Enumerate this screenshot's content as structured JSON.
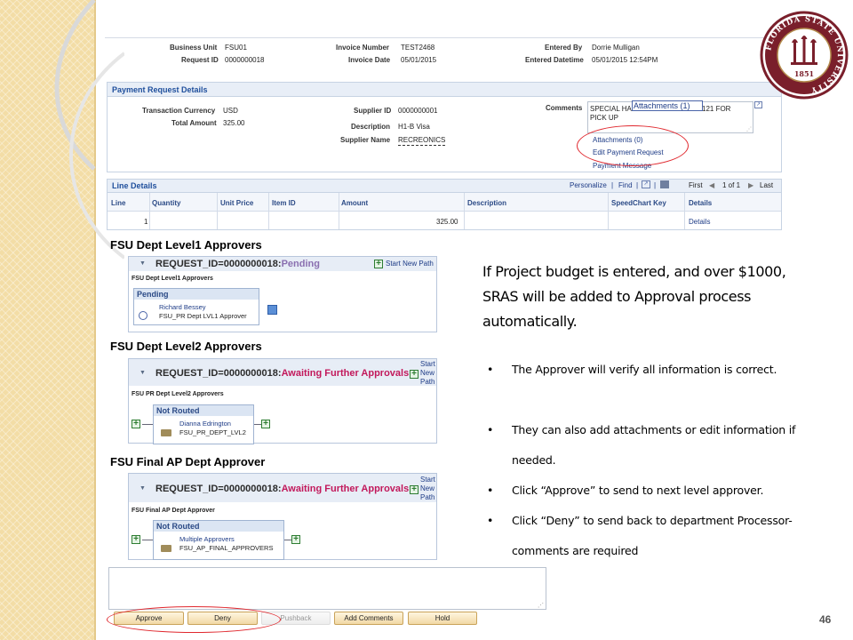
{
  "header": {
    "business_unit_label": "Business Unit",
    "business_unit": "FSU01",
    "request_id_label": "Request ID",
    "request_id": "0000000018",
    "invoice_number_label": "Invoice Number",
    "invoice_number": "TEST2468",
    "invoice_date_label": "Invoice Date",
    "invoice_date": "05/01/2015",
    "entered_by_label": "Entered By",
    "entered_by": "Dorrie Mulligan",
    "entered_datetime_label": "Entered Datetime",
    "entered_datetime": "05/01/2015 12:54PM"
  },
  "payment_request": {
    "title": "Payment Request Details",
    "currency_label": "Transaction Currency",
    "currency": "USD",
    "total_label": "Total Amount",
    "total": "325.00",
    "supplier_id_label": "Supplier ID",
    "supplier_id": "0000000001",
    "description_label": "Description",
    "description": "H1-B Visa",
    "supplier_name_label": "Supplier Name",
    "supplier_name": "RECREONICS",
    "comments_label": "Comments",
    "comments_line1": "SPECIAL HA",
    "comments_tail": "121 FOR",
    "comments_line2": "PICK UP",
    "attachments_tooltip": "Attachments (1)",
    "links": [
      "Attachments (0)",
      "Edit Payment Request",
      "Payment Message"
    ]
  },
  "line_details": {
    "title": "Line Details",
    "toolbar": {
      "personalize": "Personalize",
      "find": "Find",
      "first": "First",
      "range": "1 of 1",
      "last": "Last"
    },
    "columns": [
      "Line",
      "Quantity",
      "Unit Price",
      "Item ID",
      "Amount",
      "Description",
      "SpeedChart Key",
      "Details"
    ],
    "rows": [
      {
        "line": "1",
        "amount": "325.00",
        "details": "Details"
      }
    ]
  },
  "approvals": [
    {
      "heading": "FSU Dept Level1 Approvers",
      "request": "REQUEST_ID=0000000018:",
      "status": "Pending",
      "status_color": "#8a6fb0",
      "start_path": "Start New Path",
      "path_name": "FSU Dept Level1 Approvers",
      "stage": "Pending",
      "approver": "Richard Bessey",
      "role": "FSU_PR Dept LVL1 Approver"
    },
    {
      "heading": "FSU Dept Level2 Approvers",
      "request": "REQUEST_ID=0000000018:",
      "status": "Awaiting Further Approvals",
      "status_color": "#c2185b",
      "start_lines": [
        "Start",
        "New",
        "Path"
      ],
      "path_name": "FSU PR Dept Level2 Approvers",
      "stage": "Not Routed",
      "approver": "Dianna Edrington",
      "role": "FSU_PR_DEPT_LVL2"
    },
    {
      "heading": "FSU Final AP Dept Approver",
      "request": "REQUEST_ID=0000000018:",
      "status": "Awaiting Further Approvals",
      "status_color": "#c2185b",
      "start_lines": [
        "Start",
        "New",
        "Path"
      ],
      "path_name": "FSU Final AP Dept Approver",
      "stage": "Not Routed",
      "approver": "Multiple Approvers",
      "role": "FSU_AP_FINAL_APPROVERS"
    }
  ],
  "buttons": [
    "Approve",
    "Deny",
    "Pushback",
    "Add Comments",
    "Hold"
  ],
  "callout": "If Project budget is entered, and over $1000, SRAS will be added to Approval process automatically.",
  "bullets": [
    "The Approver will verify all information is correct.",
    "They can also add attachments or edit information if needed.",
    "Click “Approve” to send to next level approver.",
    "Click “Deny” to send back to department Processor- comments are required"
  ],
  "seal": {
    "text_top": "FLORIDA STATE UNIVERSITY",
    "year": "1851"
  },
  "page_number": "46",
  "colors": {
    "accent_red": "#e0282e",
    "link_blue": "#1d3b86",
    "seal_garnet": "#7a1f2b"
  }
}
